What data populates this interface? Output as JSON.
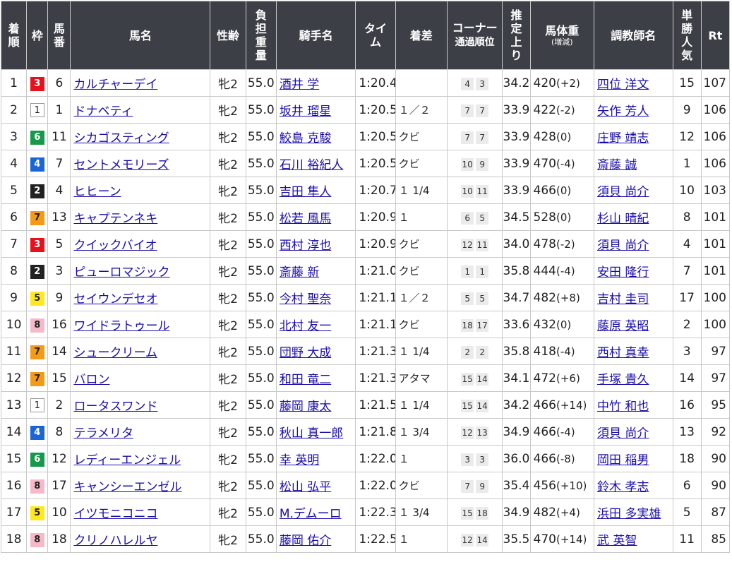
{
  "headers": {
    "rank": [
      "着",
      "順"
    ],
    "waku": "枠",
    "num": [
      "馬",
      "番"
    ],
    "horse": "馬名",
    "sexage": "性齢",
    "weight": [
      "負",
      "担",
      "重",
      "量"
    ],
    "jockey": "騎手名",
    "time": [
      "タイ",
      "ム"
    ],
    "margin": "着差",
    "corner": [
      "コーナー",
      "通過順位"
    ],
    "last3f": [
      "推",
      "定",
      "上",
      "り"
    ],
    "bodyweight": "馬体重",
    "bodyweight_sub": "(増減)",
    "trainer": "調教師名",
    "pop": [
      "単",
      "勝",
      "人",
      "気"
    ],
    "rt": "Rt"
  },
  "waku_colors": {
    "1": "#ffffff",
    "2": "#222222",
    "3": "#e8101b",
    "4": "#1a66d6",
    "5": "#ffe81e",
    "6": "#16994a",
    "7": "#f59a16",
    "8": "#f7b9c8"
  },
  "rows": [
    {
      "rank": "1",
      "waku": "3",
      "num": "6",
      "horse": "カルチャーデイ",
      "sexage": "牝2",
      "weight": "55.0",
      "jockey": "酒井 学",
      "time": "1:20.4",
      "margin": "",
      "c1": "4",
      "c2": "3",
      "last3f": "34.2",
      "bw": "420",
      "bwd": "(+2)",
      "trainer": "四位 洋文",
      "pop": "15",
      "rt": "107"
    },
    {
      "rank": "2",
      "waku": "1",
      "num": "1",
      "horse": "ドナベティ",
      "sexage": "牝2",
      "weight": "55.0",
      "jockey": "坂井 瑠星",
      "time": "1:20.5",
      "margin": "１／２",
      "c1": "7",
      "c2": "7",
      "last3f": "33.9",
      "bw": "422",
      "bwd": "(-2)",
      "trainer": "矢作 芳人",
      "pop": "9",
      "rt": "106"
    },
    {
      "rank": "3",
      "waku": "6",
      "num": "11",
      "horse": "シカゴスティング",
      "sexage": "牝2",
      "weight": "55.0",
      "jockey": "鮫島 克駿",
      "time": "1:20.5",
      "margin": "クビ",
      "c1": "7",
      "c2": "7",
      "last3f": "33.9",
      "bw": "428",
      "bwd": "(0)",
      "trainer": "庄野 靖志",
      "pop": "12",
      "rt": "106"
    },
    {
      "rank": "4",
      "waku": "4",
      "num": "7",
      "horse": "セントメモリーズ",
      "sexage": "牝2",
      "weight": "55.0",
      "jockey": "石川 裕紀人",
      "time": "1:20.5",
      "margin": "クビ",
      "c1": "10",
      "c2": "9",
      "last3f": "33.9",
      "bw": "470",
      "bwd": "(-4)",
      "trainer": "斎藤 誠",
      "pop": "1",
      "rt": "106"
    },
    {
      "rank": "5",
      "waku": "2",
      "num": "4",
      "horse": "ヒヒーン",
      "sexage": "牝2",
      "weight": "55.0",
      "jockey": "吉田 隼人",
      "time": "1:20.7",
      "margin": "１ 1/4",
      "c1": "10",
      "c2": "11",
      "last3f": "33.9",
      "bw": "466",
      "bwd": "(0)",
      "trainer": "須貝 尚介",
      "pop": "10",
      "rt": "103"
    },
    {
      "rank": "6",
      "waku": "7",
      "num": "13",
      "horse": "キャプテンネキ",
      "sexage": "牝2",
      "weight": "55.0",
      "jockey": "松若 風馬",
      "time": "1:20.9",
      "margin": "１",
      "c1": "6",
      "c2": "5",
      "last3f": "34.5",
      "bw": "528",
      "bwd": "(0)",
      "trainer": "杉山 晴紀",
      "pop": "8",
      "rt": "101"
    },
    {
      "rank": "7",
      "waku": "3",
      "num": "5",
      "horse": "クイックバイオ",
      "sexage": "牝2",
      "weight": "55.0",
      "jockey": "西村 淳也",
      "time": "1:20.9",
      "margin": "クビ",
      "c1": "12",
      "c2": "11",
      "last3f": "34.0",
      "bw": "478",
      "bwd": "(-2)",
      "trainer": "須貝 尚介",
      "pop": "4",
      "rt": "101"
    },
    {
      "rank": "8",
      "waku": "2",
      "num": "3",
      "horse": "ピューロマジック",
      "sexage": "牝2",
      "weight": "55.0",
      "jockey": "斎藤 新",
      "time": "1:21.0",
      "margin": "クビ",
      "c1": "1",
      "c2": "1",
      "last3f": "35.8",
      "bw": "444",
      "bwd": "(-4)",
      "trainer": "安田 隆行",
      "pop": "7",
      "rt": "101"
    },
    {
      "rank": "9",
      "waku": "5",
      "num": "9",
      "horse": "セイウンデセオ",
      "sexage": "牝2",
      "weight": "55.0",
      "jockey": "今村 聖奈",
      "time": "1:21.1",
      "margin": "１／２",
      "c1": "5",
      "c2": "5",
      "last3f": "34.7",
      "bw": "482",
      "bwd": "(+8)",
      "trainer": "吉村 圭司",
      "pop": "17",
      "rt": "100"
    },
    {
      "rank": "10",
      "waku": "8",
      "num": "16",
      "horse": "ワイドラトゥール",
      "sexage": "牝2",
      "weight": "55.0",
      "jockey": "北村 友一",
      "time": "1:21.1",
      "margin": "クビ",
      "c1": "18",
      "c2": "17",
      "last3f": "33.6",
      "bw": "432",
      "bwd": "(0)",
      "trainer": "藤原 英昭",
      "pop": "2",
      "rt": "100"
    },
    {
      "rank": "11",
      "waku": "7",
      "num": "14",
      "horse": "シュークリーム",
      "sexage": "牝2",
      "weight": "55.0",
      "jockey": "団野 大成",
      "time": "1:21.3",
      "margin": "１ 1/4",
      "c1": "2",
      "c2": "2",
      "last3f": "35.8",
      "bw": "418",
      "bwd": "(-4)",
      "trainer": "西村 真幸",
      "pop": "3",
      "rt": "97"
    },
    {
      "rank": "12",
      "waku": "7",
      "num": "15",
      "horse": "バロン",
      "sexage": "牝2",
      "weight": "55.0",
      "jockey": "和田 竜二",
      "time": "1:21.3",
      "margin": "アタマ",
      "c1": "15",
      "c2": "14",
      "last3f": "34.1",
      "bw": "472",
      "bwd": "(+6)",
      "trainer": "手塚 貴久",
      "pop": "14",
      "rt": "97"
    },
    {
      "rank": "13",
      "waku": "1",
      "num": "2",
      "horse": "ロータスワンド",
      "sexage": "牝2",
      "weight": "55.0",
      "jockey": "藤岡 康太",
      "time": "1:21.5",
      "margin": "１ 1/4",
      "c1": "15",
      "c2": "14",
      "last3f": "34.2",
      "bw": "466",
      "bwd": "(+14)",
      "trainer": "中竹 和也",
      "pop": "16",
      "rt": "95"
    },
    {
      "rank": "14",
      "waku": "4",
      "num": "8",
      "horse": "テラメリタ",
      "sexage": "牝2",
      "weight": "55.0",
      "jockey": "秋山 真一郎",
      "time": "1:21.8",
      "margin": "１ 3/4",
      "c1": "12",
      "c2": "13",
      "last3f": "34.9",
      "bw": "466",
      "bwd": "(-4)",
      "trainer": "須貝 尚介",
      "pop": "13",
      "rt": "92"
    },
    {
      "rank": "15",
      "waku": "6",
      "num": "12",
      "horse": "レディーエンジェル",
      "sexage": "牝2",
      "weight": "55.0",
      "jockey": "幸 英明",
      "time": "1:22.0",
      "margin": "１",
      "c1": "3",
      "c2": "3",
      "last3f": "36.0",
      "bw": "466",
      "bwd": "(-8)",
      "trainer": "岡田 稲男",
      "pop": "18",
      "rt": "90"
    },
    {
      "rank": "16",
      "waku": "8",
      "num": "17",
      "horse": "キャンシーエンゼル",
      "sexage": "牝2",
      "weight": "55.0",
      "jockey": "松山 弘平",
      "time": "1:22.0",
      "margin": "クビ",
      "c1": "7",
      "c2": "9",
      "last3f": "35.4",
      "bw": "456",
      "bwd": "(+10)",
      "trainer": "鈴木 孝志",
      "pop": "6",
      "rt": "90"
    },
    {
      "rank": "17",
      "waku": "5",
      "num": "10",
      "horse": "イツモニコニコ",
      "sexage": "牝2",
      "weight": "55.0",
      "jockey": "M.デムーロ",
      "time": "1:22.3",
      "margin": "１ 3/4",
      "c1": "15",
      "c2": "18",
      "last3f": "34.9",
      "bw": "482",
      "bwd": "(+4)",
      "trainer": "浜田 多実雄",
      "pop": "5",
      "rt": "87"
    },
    {
      "rank": "18",
      "waku": "8",
      "num": "18",
      "horse": "クリノハレルヤ",
      "sexage": "牝2",
      "weight": "55.0",
      "jockey": "藤岡 佑介",
      "time": "1:22.5",
      "margin": "１",
      "c1": "12",
      "c2": "14",
      "last3f": "35.5",
      "bw": "470",
      "bwd": "(+14)",
      "trainer": "武 英智",
      "pop": "11",
      "rt": "85"
    }
  ]
}
